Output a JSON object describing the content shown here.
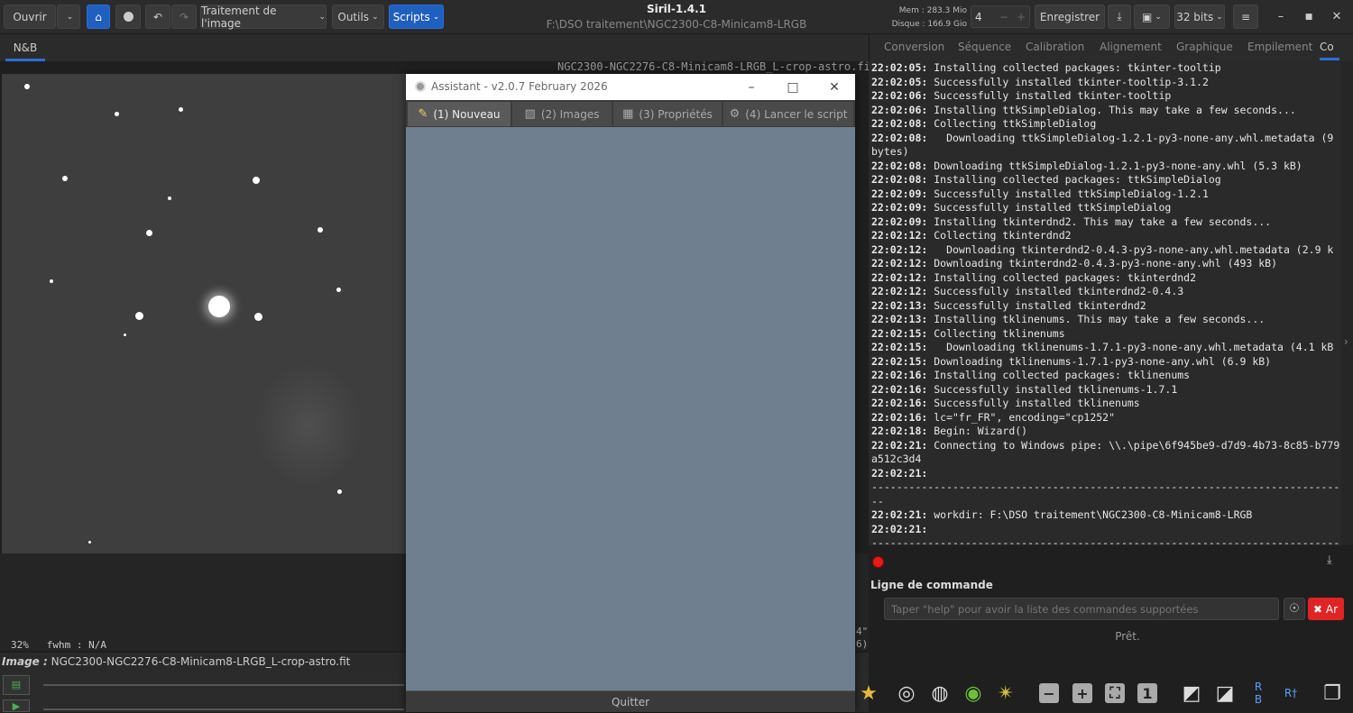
{
  "header": {
    "open_label": "Ouvrir",
    "processing_menu": "Traitement de l'image",
    "tools_menu": "Outils",
    "scripts_menu": "Scripts",
    "app_title": "Siril-1.4.1",
    "path": "F:\\DSO traitement\\NGC2300-C8-Minicam8-LRGB",
    "mem": "Mem : 283.3 Mio",
    "disk": "Disque : 166.9 Gio",
    "threads": "4",
    "save_label": "Enregistrer",
    "bits_label": "32 bits"
  },
  "left": {
    "tab_label": "N&B",
    "image_name": "NGC2300-NGC2276-C8-Minicam8-LRGB_L-crop-astro.fit",
    "zoom_info": "32%   fwhm : N/A",
    "image_label": "Image :",
    "image_file": "NGC2300-NGC2276-C8-Minicam8-LRGB_L-crop-astro.fit"
  },
  "right_tabs": [
    "Conversion",
    "Séquence",
    "Calibration",
    "Alignement",
    "Graphique",
    "Empilement",
    "Co"
  ],
  "console_lines": [
    {
      "ts": "22:02:05:",
      "msg": " Installing collected packages: tkinter-tooltip"
    },
    {
      "ts": "22:02:05:",
      "msg": " Successfully installed tkinter-tooltip-3.1.2"
    },
    {
      "ts": "22:02:06:",
      "msg": " Successfully installed tkinter-tooltip"
    },
    {
      "ts": "22:02:06:",
      "msg": " Installing ttkSimpleDialog. This may take a few seconds..."
    },
    {
      "ts": "22:02:08:",
      "msg": " Collecting ttkSimpleDialog"
    },
    {
      "ts": "22:02:08:",
      "msg": "   Downloading ttkSimpleDialog-1.2.1-py3-none-any.whl.metadata (9 bytes)"
    },
    {
      "ts": "22:02:08:",
      "msg": " Downloading ttkSimpleDialog-1.2.1-py3-none-any.whl (5.3 kB)"
    },
    {
      "ts": "22:02:08:",
      "msg": " Installing collected packages: ttkSimpleDialog"
    },
    {
      "ts": "22:02:09:",
      "msg": " Successfully installed ttkSimpleDialog-1.2.1"
    },
    {
      "ts": "22:02:09:",
      "msg": " Successfully installed ttkSimpleDialog"
    },
    {
      "ts": "22:02:09:",
      "msg": " Installing tkinterdnd2. This may take a few seconds..."
    },
    {
      "ts": "22:02:12:",
      "msg": " Collecting tkinterdnd2"
    },
    {
      "ts": "22:02:12:",
      "msg": "   Downloading tkinterdnd2-0.4.3-py3-none-any.whl.metadata (2.9 k"
    },
    {
      "ts": "22:02:12:",
      "msg": " Downloading tkinterdnd2-0.4.3-py3-none-any.whl (493 kB)"
    },
    {
      "ts": "22:02:12:",
      "msg": " Installing collected packages: tkinterdnd2"
    },
    {
      "ts": "22:02:12:",
      "msg": " Successfully installed tkinterdnd2-0.4.3"
    },
    {
      "ts": "22:02:13:",
      "msg": " Successfully installed tkinterdnd2"
    },
    {
      "ts": "22:02:13:",
      "msg": " Installing tklinenums. This may take a few seconds..."
    },
    {
      "ts": "22:02:15:",
      "msg": " Collecting tklinenums"
    },
    {
      "ts": "22:02:15:",
      "msg": "   Downloading tklinenums-1.7.1-py3-none-any.whl.metadata (4.1 kB"
    },
    {
      "ts": "22:02:15:",
      "msg": " Downloading tklinenums-1.7.1-py3-none-any.whl (6.9 kB)"
    },
    {
      "ts": "22:02:16:",
      "msg": " Installing collected packages: tklinenums"
    },
    {
      "ts": "22:02:16:",
      "msg": " Successfully installed tklinenums-1.7.1"
    },
    {
      "ts": "22:02:16:",
      "msg": " Successfully installed tklinenums"
    },
    {
      "ts": "22:02:16:",
      "msg": " lc=\"fr_FR\", encoding=\"cp1252\""
    },
    {
      "ts": "22:02:18:",
      "msg": " Begin: Wizard()"
    },
    {
      "ts": "22:02:21:",
      "msg": " Connecting to Windows pipe: \\\\.\\pipe\\6f945be9-d7d9-4b73-8c85-b779a512c3d4"
    },
    {
      "ts": "22:02:21:",
      "msg": ""
    },
    {
      "ts": "",
      "msg": "-----------------------------------------------------------------------------"
    },
    {
      "ts": "22:02:21:",
      "msg": " workdir: F:\\DSO traitement\\NGC2300-C8-Minicam8-LRGB"
    },
    {
      "ts": "22:02:21:",
      "msg": ""
    },
    {
      "ts": "",
      "msg": "-----------------------------------------------------------------------------"
    }
  ],
  "command": {
    "title": "Ligne de commande",
    "placeholder": "Taper \"help\" pour avoir la liste des commandes supportées",
    "abort_label": "Ar",
    "status": "Prêt."
  },
  "right_trunc": "4\"\n6)",
  "dialog": {
    "title": "Assistant - v2.0.7 February 2026",
    "tabs": [
      "(1) Nouveau",
      "(2) Images",
      "(3) Propriétés",
      "(4) Lancer le script"
    ],
    "quit_label": "Quitter"
  },
  "colors": {
    "accent": "#1f5fbf",
    "abort": "#e02424",
    "dialog_bg": "#6f7f8f"
  }
}
